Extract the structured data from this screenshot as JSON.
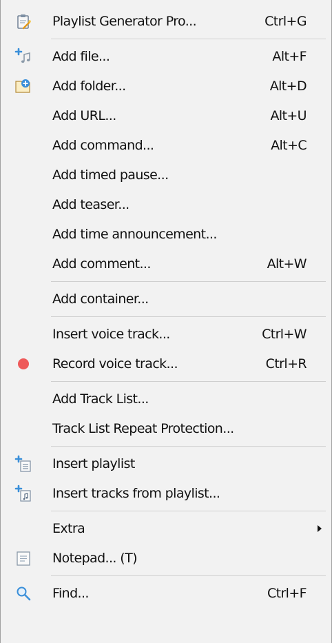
{
  "menu": {
    "generator": {
      "label": "Playlist Generator Pro...",
      "shortcut": "Ctrl+G",
      "icon": "clipboard-wand-icon"
    },
    "add_file": {
      "label": "Add file...",
      "shortcut": "Alt+F",
      "icon": "add-music-note-icon"
    },
    "add_folder": {
      "label": "Add folder...",
      "shortcut": "Alt+D",
      "icon": "add-folder-icon"
    },
    "add_url": {
      "label": "Add URL...",
      "shortcut": "Alt+U"
    },
    "add_command": {
      "label": "Add command...",
      "shortcut": "Alt+C"
    },
    "add_timed_pause": {
      "label": "Add timed pause..."
    },
    "add_teaser": {
      "label": "Add teaser..."
    },
    "add_time_announcement": {
      "label": "Add time announcement..."
    },
    "add_comment": {
      "label": "Add comment...",
      "shortcut": "Alt+W"
    },
    "add_container": {
      "label": "Add container..."
    },
    "insert_voice_track": {
      "label": "Insert voice track...",
      "shortcut": "Ctrl+W"
    },
    "record_voice_track": {
      "label": "Record voice track...",
      "shortcut": "Ctrl+R",
      "icon": "record-icon"
    },
    "add_track_list": {
      "label": "Add Track List..."
    },
    "track_list_repeat_protection": {
      "label": "Track List Repeat Protection..."
    },
    "insert_playlist": {
      "label": "Insert playlist",
      "icon": "insert-playlist-icon"
    },
    "insert_tracks_from_playlist": {
      "label": "Insert tracks from playlist...",
      "icon": "insert-tracks-icon"
    },
    "extra": {
      "label": "Extra"
    },
    "notepad": {
      "label": "Notepad... (T)",
      "icon": "notepad-icon"
    },
    "find": {
      "label": "Find...",
      "shortcut": "Ctrl+F",
      "icon": "magnifier-icon"
    }
  },
  "colors": {
    "menu_background": "#f2f2f2",
    "separator": "#cfcfcf",
    "record_red": "#ee5a5a",
    "icon_blue": "#3a8fd9"
  }
}
